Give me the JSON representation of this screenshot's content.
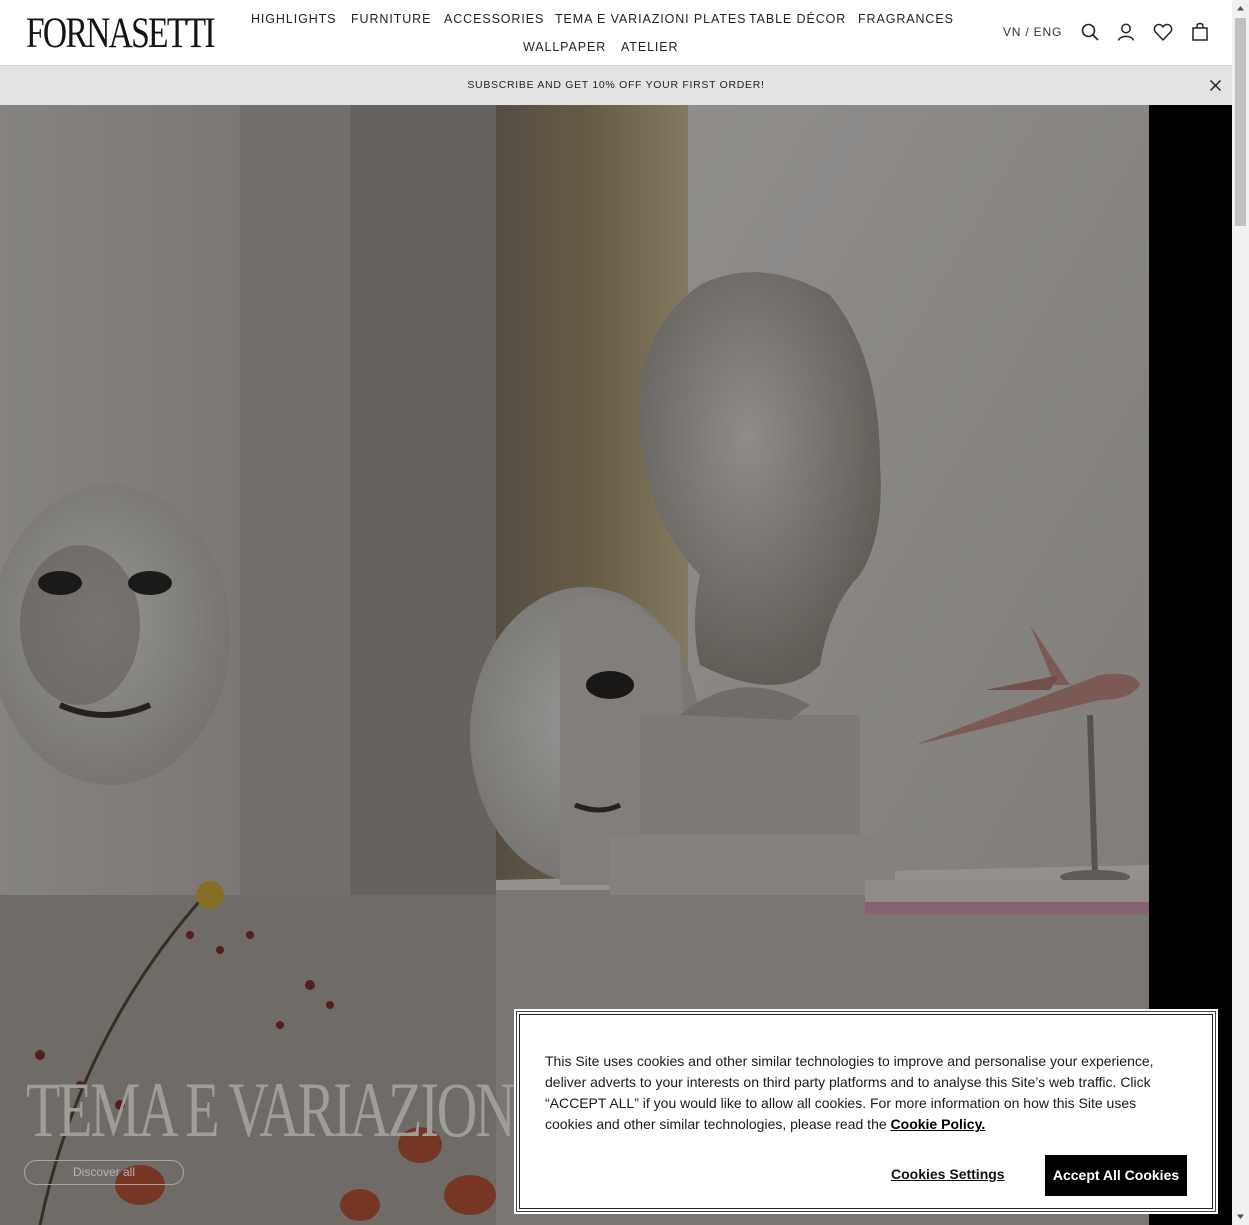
{
  "header": {
    "logo": "FORNASETTI",
    "nav": [
      {
        "label": "HIGHLIGHTS"
      },
      {
        "label": "FURNITURE"
      },
      {
        "label": "ACCESSORIES"
      },
      {
        "label": "TEMA E VARIAZIONI PLATES"
      },
      {
        "label": "TABLE DÉCOR"
      },
      {
        "label": "FRAGRANCES"
      },
      {
        "label": "WALLPAPER"
      },
      {
        "label": "ATELIER"
      }
    ],
    "language": "VN / ENG",
    "icons": [
      "search-icon",
      "account-icon",
      "wishlist-heart-icon",
      "shopping-bag-icon"
    ]
  },
  "promo": {
    "text": "SUBSCRIBE AND GET 10% OFF YOUR FIRST ORDER!",
    "close_icon": "close-icon"
  },
  "hero": {
    "title": "TEMA E VARIAZIONI",
    "cta": "Discover all"
  },
  "cookie_banner": {
    "text": "This Site uses cookies and other similar technologies to improve and personalise your experience, deliver adverts to your interests on third party platforms and to analyse this Site’s web traffic. Click “ACCEPT ALL” if you would like to allow all cookies. For more information on how this Site uses cookies and other similar technologies, please read the ",
    "link": "Cookie Policy.",
    "settings_label": "Cookies Settings",
    "accept_label": "Accept All Cookies"
  },
  "colors": {
    "accent": "#000000",
    "promo_bg": "#e3e3e3",
    "hero_title": "#a09d98"
  }
}
